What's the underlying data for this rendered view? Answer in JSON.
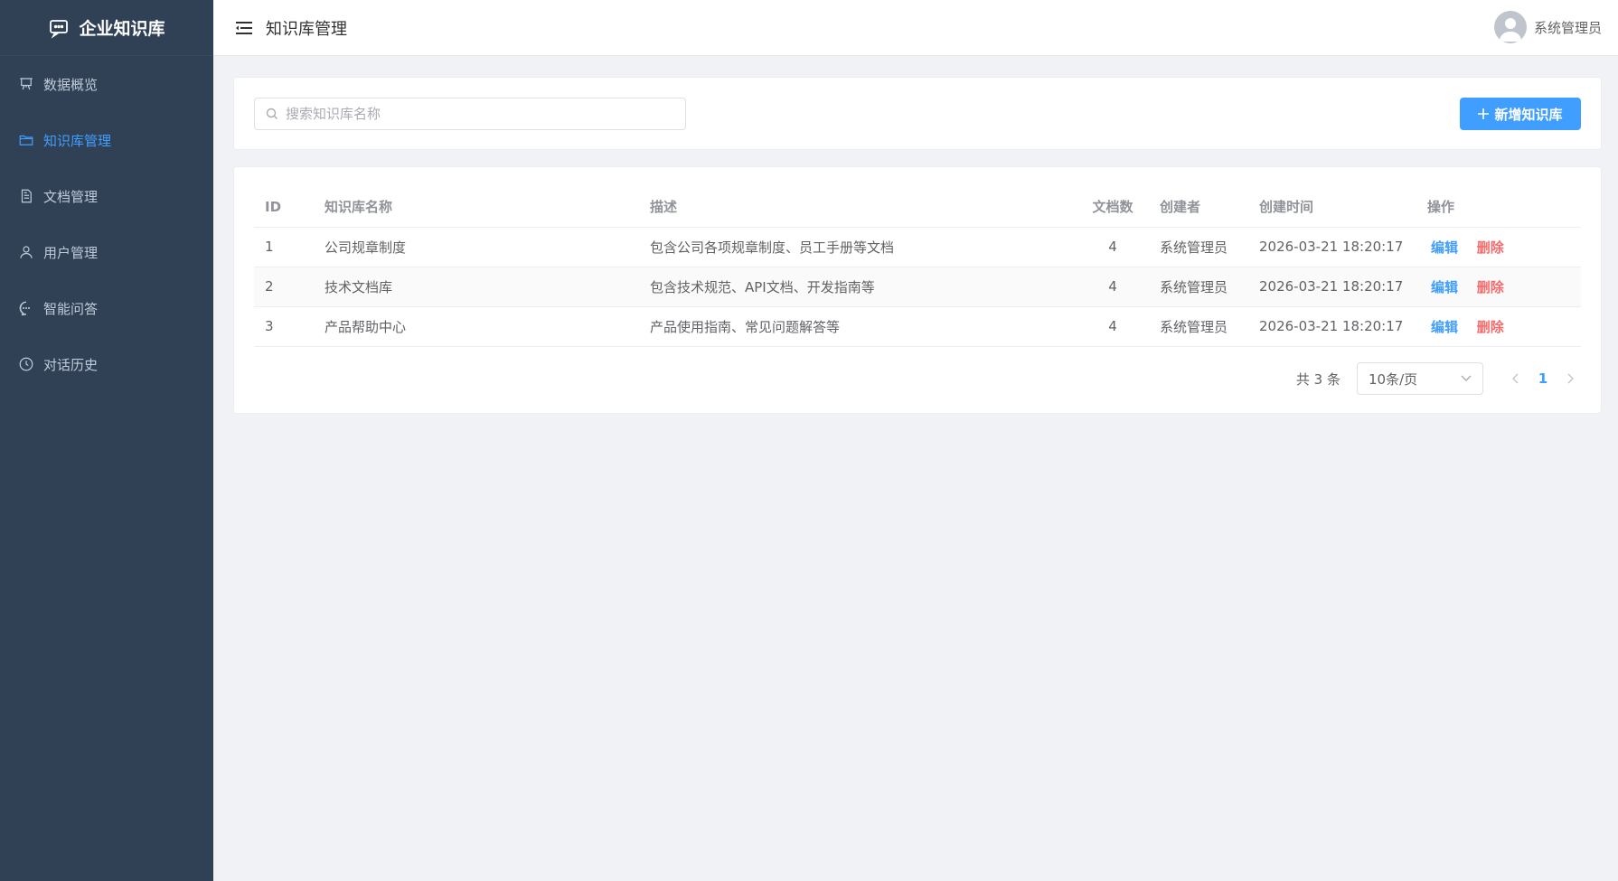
{
  "brand": {
    "title": "企业知识库",
    "icon": "chat-icon"
  },
  "sidebar": {
    "items": [
      {
        "label": "数据概览",
        "icon": "presentation-icon"
      },
      {
        "label": "知识库管理",
        "icon": "folder-icon",
        "active": true
      },
      {
        "label": "文档管理",
        "icon": "document-icon"
      },
      {
        "label": "用户管理",
        "icon": "user-icon"
      },
      {
        "label": "智能问答",
        "icon": "chat-bubble-icon"
      },
      {
        "label": "对话历史",
        "icon": "clock-icon"
      }
    ]
  },
  "header": {
    "title": "知识库管理",
    "user_name": "系统管理员"
  },
  "search": {
    "placeholder": "搜索知识库名称",
    "value": ""
  },
  "toolbar": {
    "add_label": "新增知识库"
  },
  "table": {
    "columns": [
      "ID",
      "知识库名称",
      "描述",
      "文档数",
      "创建者",
      "创建时间",
      "操作"
    ],
    "rows": [
      {
        "id": "1",
        "name": "公司规章制度",
        "desc": "包含公司各项规章制度、员工手册等文档",
        "docs": "4",
        "creator": "系统管理员",
        "created": "2026-03-21 18:20:17"
      },
      {
        "id": "2",
        "name": "技术文档库",
        "desc": "包含技术规范、API文档、开发指南等",
        "docs": "4",
        "creator": "系统管理员",
        "created": "2026-03-21 18:20:17"
      },
      {
        "id": "3",
        "name": "产品帮助中心",
        "desc": "产品使用指南、常见问题解答等",
        "docs": "4",
        "creator": "系统管理员",
        "created": "2026-03-21 18:20:17"
      }
    ],
    "edit_label": "编辑",
    "delete_label": "删除"
  },
  "pagination": {
    "total": "共 3 条",
    "page_size": "10条/页",
    "current": "1"
  },
  "colors": {
    "sidebar_bg": "#304156",
    "accent": "#409eff",
    "danger": "#f56c6c"
  }
}
